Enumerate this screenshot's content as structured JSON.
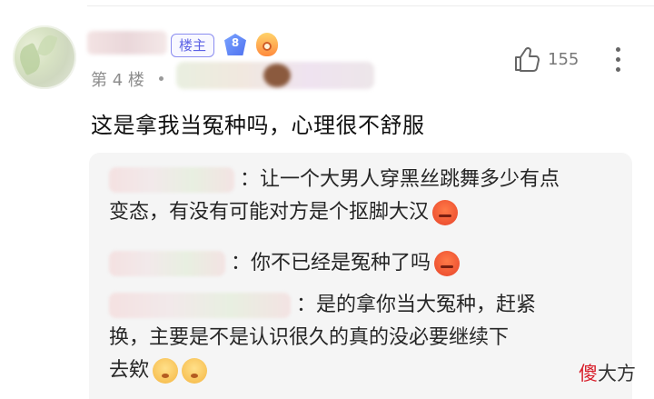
{
  "post": {
    "owner_badge": "楼主",
    "level": "8",
    "floor": "第 4 楼",
    "likes": "155",
    "content": "这是拿我当冤种吗，心理很不舒服"
  },
  "replies": [
    {
      "lines": [
        "：让一个大男人穿黑丝跳舞多少有点",
        "变态，有没有可能对方是个抠脚大汉"
      ],
      "emoji": [
        "angry-face-icon"
      ]
    },
    {
      "lines": [
        "：你不已经是冤种了吗"
      ],
      "emoji": [
        "angry-face-icon"
      ]
    },
    {
      "lines": [
        "：是的拿你当大冤种，赶紧",
        "换，主要是不是认识很久的真的没必要继续下",
        "去欸"
      ],
      "emoji": [
        "worried-face-icon",
        "worried-face-icon"
      ]
    }
  ],
  "watermark": {
    "part1": "傻",
    "part2": "大方"
  }
}
